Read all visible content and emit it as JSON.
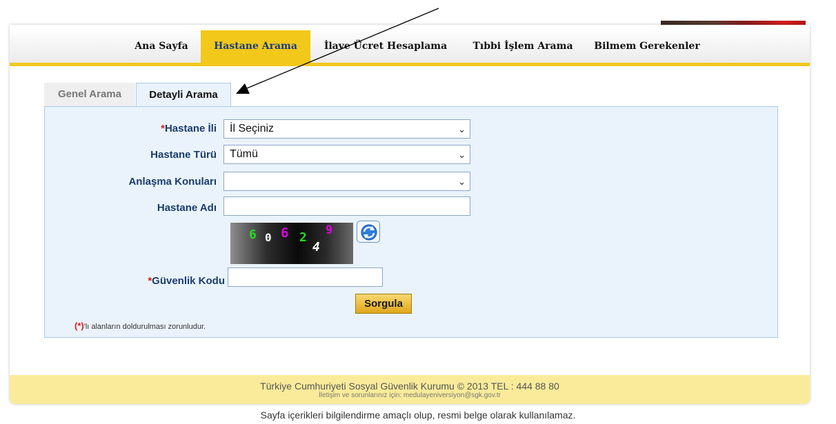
{
  "nav": {
    "items": [
      {
        "label": "Ana Sayfa"
      },
      {
        "label": "Hastane Arama"
      },
      {
        "label": "İlave Ücret Hesaplama"
      },
      {
        "label": "Tıbbi İşlem Arama"
      },
      {
        "label": "Bilmem Gerekenler"
      }
    ],
    "active_index": 1
  },
  "tabs": [
    {
      "label": "Genel Arama",
      "active": false
    },
    {
      "label": "Detayli Arama",
      "active": true
    }
  ],
  "form": {
    "required_mark": "*",
    "hastane_ili": {
      "label": "Hastane İli",
      "required": true,
      "value": "İl Seçiniz"
    },
    "hastane_turu": {
      "label": "Hastane Türü",
      "required": false,
      "value": "Tümü"
    },
    "anlasma_konulari": {
      "label": "Anlaşma Konuları",
      "required": false,
      "value": ""
    },
    "hastane_adi": {
      "label": "Hastane Adı",
      "required": false,
      "value": ""
    },
    "captcha": {
      "digits": [
        "6",
        "0",
        "6",
        "2",
        "4",
        "9"
      ]
    },
    "guvenlik_kodu": {
      "label": "Güvenlik Kodu",
      "required": true,
      "value": ""
    },
    "submit_label": "Sorgula",
    "required_note_mark": "(*)",
    "required_note_text": "'lı alanların doldurulması zorunludur."
  },
  "footer": {
    "line1": "Türkiye Cumhuriyeti Sosyal Güvenlik Kurumu © 2013 TEL : 444 88 80",
    "line2": "İletişim ve sorunlarınız için: medulayeniversiyon@sgk.gov.tr",
    "disclaimer": "Sayfa içerikleri bilgilendirme amaçlı olup, resmi belge olarak kullanılamaz."
  },
  "colors": {
    "accent_yellow": "#f2c81a",
    "nav_active_text": "#1a3d80",
    "label_blue": "#1a3d6e",
    "required_red": "#d81c1c",
    "panel_bg": "#eaf3fb",
    "footer_bg": "#faeb9a"
  },
  "icons": {
    "select_chevron": "chevron-down-icon",
    "captcha_refresh": "refresh-icon",
    "annotation": "arrow-icon"
  }
}
